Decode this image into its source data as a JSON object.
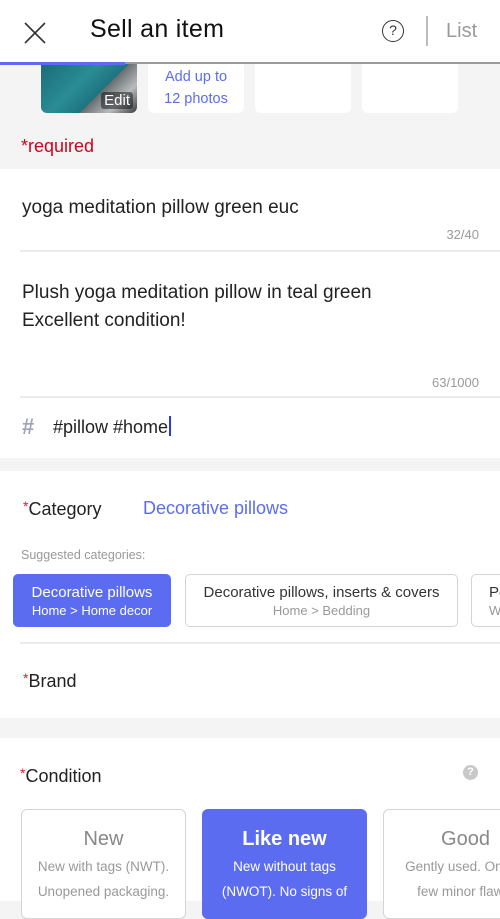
{
  "header": {
    "title": "Sell an item",
    "close_icon": "close-icon",
    "help_icon": "question-circle-icon",
    "help_glyph": "?",
    "list_label": "List"
  },
  "progress": {
    "fraction": 0.25,
    "color": "#5b6cf0"
  },
  "photos": {
    "edit_label": "Edit",
    "add_line1": "Add up to",
    "add_line2": "12 photos"
  },
  "required_label": "*required",
  "listing": {
    "title_value": "yoga meditation pillow green euc",
    "title_count": "32/40",
    "description_line1": "Plush yoga meditation pillow in teal green",
    "description_line2": "Excellent condition!",
    "description_count": "63/1000",
    "hashtag_icon": "#",
    "hashtags_value": "#pillow #home"
  },
  "category": {
    "required_mark": "*",
    "label": "Category",
    "value": "Decorative pillows",
    "suggested_label": "Suggested categories:",
    "suggestions": [
      {
        "name": "Decorative pillows",
        "path": "Home > Home decor",
        "selected": true
      },
      {
        "name": "Decorative pillows, inserts & covers",
        "path": "Home > Bedding",
        "selected": false
      },
      {
        "name": "Pe",
        "path": "Wo",
        "selected": false
      }
    ]
  },
  "brand": {
    "required_mark": "*",
    "label": "Brand"
  },
  "condition": {
    "required_mark": "*",
    "label": "Condition",
    "help_glyph": "?",
    "options": [
      {
        "title": "New",
        "line1": "New with tags (NWT).",
        "line2": "Unopened packaging.",
        "selected": false
      },
      {
        "title": "Like new",
        "line1": "New without tags",
        "line2": "(NWOT). No signs of",
        "selected": true
      },
      {
        "title": "Good",
        "line1": "Gently used. One or",
        "line2": "few minor flaws.",
        "selected": false
      }
    ]
  },
  "colors": {
    "accent": "#5b6cf0",
    "required": "#d0021b"
  }
}
